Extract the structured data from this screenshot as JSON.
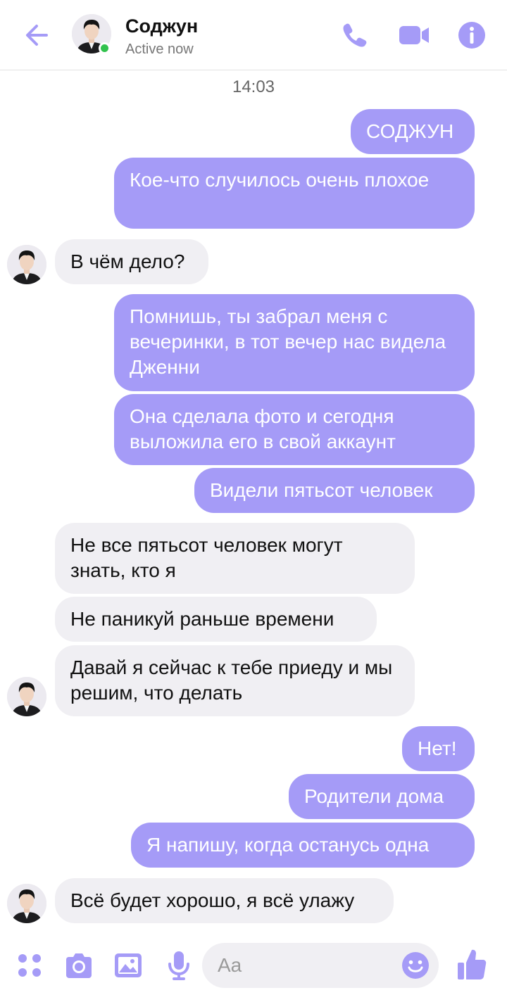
{
  "header": {
    "contact_name": "Соджун",
    "status": "Active now"
  },
  "conversation": {
    "timestamp": "14:03",
    "messages": [
      {
        "side": "out",
        "text": "СОДЖУН"
      },
      {
        "side": "out",
        "text": "Кое-что случилось очень плохое"
      },
      {
        "side": "in",
        "text": "В чём дело?"
      },
      {
        "side": "out",
        "text": "Помнишь, ты забрал меня с вечеринки, в тот вечер нас видела Дженни"
      },
      {
        "side": "out",
        "text": "Она сделала фото и сегодня выложила его в свой аккаунт"
      },
      {
        "side": "out",
        "text": "Видели пятьсот человек"
      },
      {
        "side": "in",
        "text": "Не все пятьсот человек могут знать, кто я"
      },
      {
        "side": "in",
        "text": "Не паникуй раньше времени"
      },
      {
        "side": "in",
        "text": "Давай я сейчас к тебе приеду и мы решим, что делать"
      },
      {
        "side": "out",
        "text": "Нет!"
      },
      {
        "side": "out",
        "text": "Родители дома"
      },
      {
        "side": "out",
        "text": "Я напишу, когда останусь одна"
      },
      {
        "side": "in",
        "text": "Всё будет хорошо, я всё улажу"
      }
    ]
  },
  "composer": {
    "placeholder": "Aa"
  },
  "icons": {
    "back": "back-arrow-icon",
    "call": "phone-icon",
    "video": "video-camera-icon",
    "info": "info-icon",
    "menu": "four-dots-icon",
    "camera": "camera-icon",
    "gallery": "image-icon",
    "mic": "microphone-icon",
    "emoji": "emoji-icon",
    "like": "thumbs-up-icon"
  },
  "colors": {
    "accent": "#a59bf7",
    "outgoing_bubble": "#a59bf7",
    "incoming_bubble": "#f0eff3",
    "online": "#31c24d"
  }
}
